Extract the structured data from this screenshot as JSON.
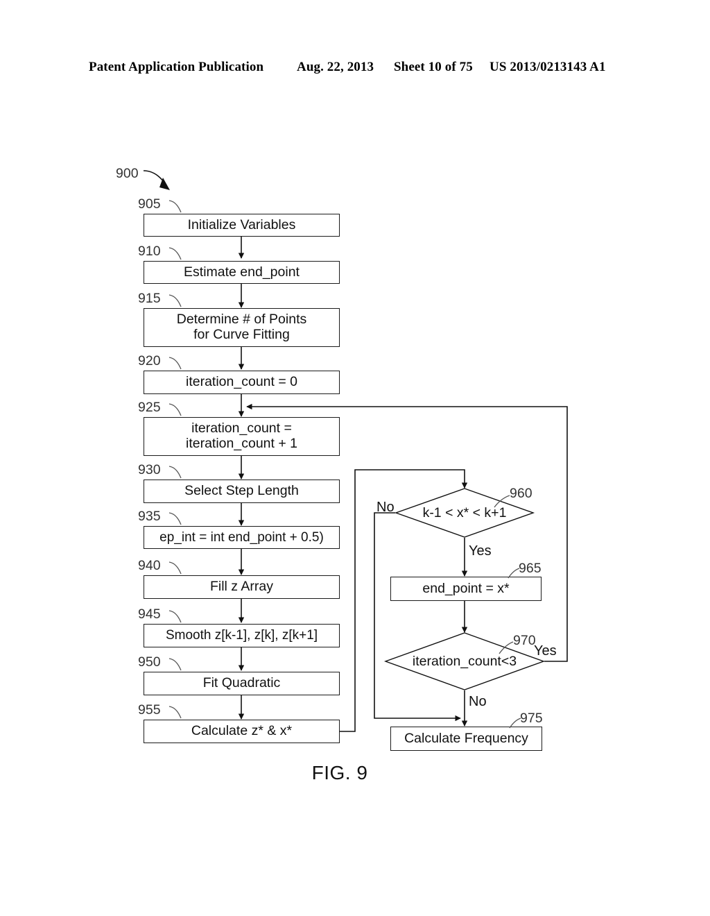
{
  "header": {
    "publication": "Patent Application Publication",
    "date": "Aug. 22, 2013",
    "sheet": "Sheet 10 of 75",
    "patent_number": "US 2013/0213143 A1"
  },
  "figure": {
    "caption": "FIG. 9",
    "flow_ref": "900",
    "nodes": [
      {
        "ref": "905",
        "text": "Initialize Variables"
      },
      {
        "ref": "910",
        "text": "Estimate end_point"
      },
      {
        "ref": "915",
        "text": "Determine # of Points\nfor Curve Fitting"
      },
      {
        "ref": "920",
        "text": "iteration_count = 0"
      },
      {
        "ref": "925",
        "text": "iteration_count =\niteration_count + 1"
      },
      {
        "ref": "930",
        "text": "Select Step Length"
      },
      {
        "ref": "935",
        "text": "ep_int = int end_point + 0.5)"
      },
      {
        "ref": "940",
        "text": "Fill z Array"
      },
      {
        "ref": "945",
        "text": "Smooth z[k-1], z[k], z[k+1]"
      },
      {
        "ref": "950",
        "text": "Fit Quadratic"
      },
      {
        "ref": "955",
        "text": "Calculate z* & x*"
      },
      {
        "ref": "960",
        "text": "k-1 < x* < k+1"
      },
      {
        "ref": "965",
        "text": "end_point = x*"
      },
      {
        "ref": "970",
        "text": "iteration_count<3"
      },
      {
        "ref": "975",
        "text": "Calculate Frequency"
      }
    ],
    "branch_labels": {
      "d960_no": "No",
      "d960_yes": "Yes",
      "d970_yes": "Yes",
      "d970_no": "No"
    }
  },
  "colors": {
    "ink": "#111111",
    "reference": "#333333",
    "background": "#ffffff"
  }
}
